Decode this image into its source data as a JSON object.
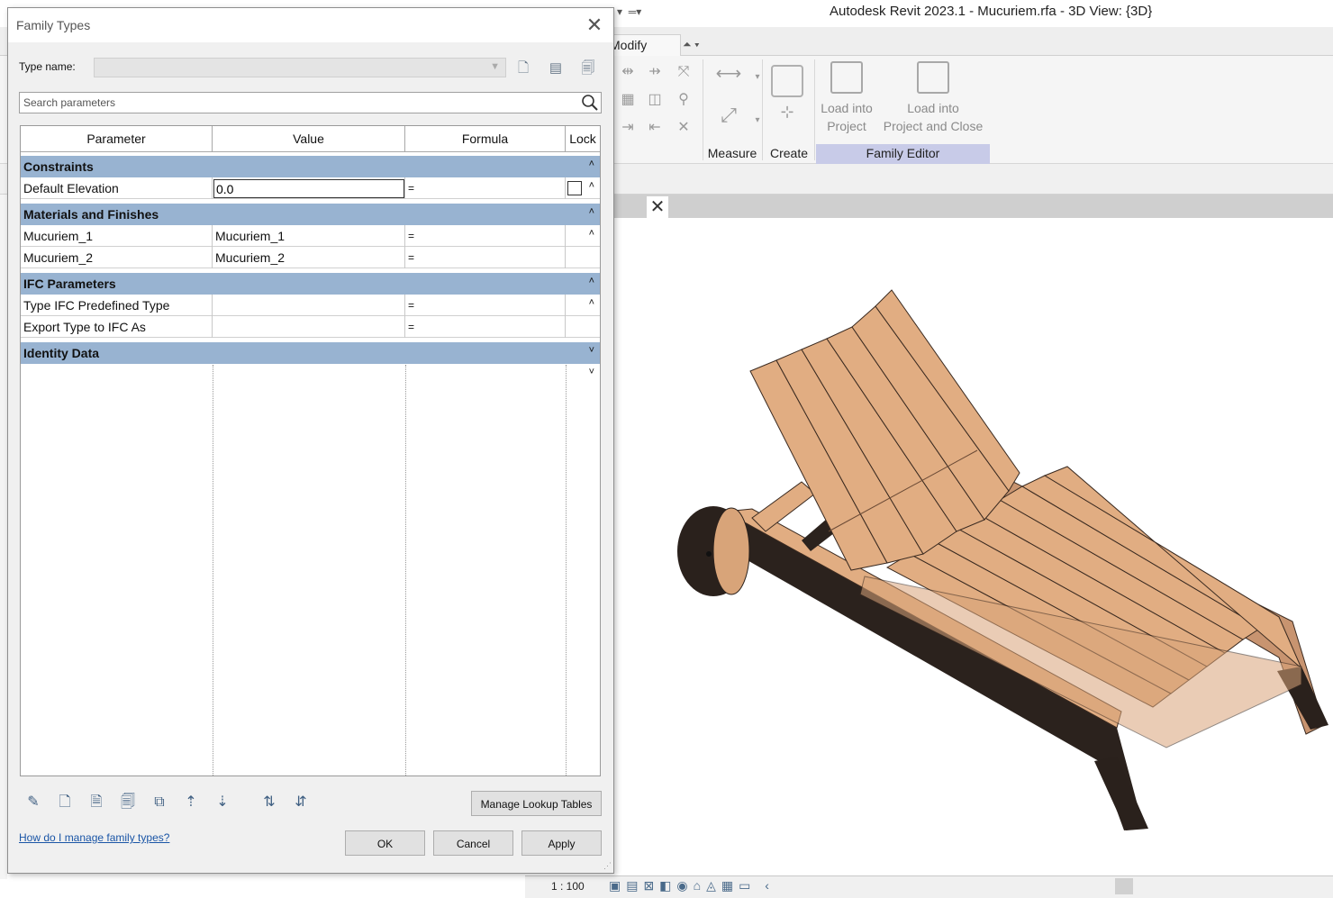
{
  "app": {
    "title": "Autodesk Revit 2023.1 - Mucuriem.rfa - 3D View: {3D}"
  },
  "ribbon": {
    "active_tab": "Modify",
    "panels": {
      "measure": "Measure",
      "create": "Create",
      "family_editor": "Family Editor"
    },
    "load_into_project": [
      "Load into",
      "Project"
    ],
    "load_into_project_close": [
      "Load into",
      "Project and Close"
    ]
  },
  "status": {
    "scale": "1 : 100"
  },
  "dialog": {
    "title": "Family Types",
    "type_name_label": "Type name:",
    "type_name_value": "",
    "search_placeholder": "Search parameters",
    "columns": [
      "Parameter",
      "Value",
      "Formula",
      "Lock"
    ],
    "groups": [
      {
        "name": "Constraints",
        "rows": [
          {
            "parameter": "Default Elevation",
            "value": "0.0",
            "formula": "=",
            "lock": false
          }
        ]
      },
      {
        "name": "Materials and Finishes",
        "rows": [
          {
            "parameter": "Mucuriem_1",
            "value": "Mucuriem_1",
            "formula": "="
          },
          {
            "parameter": "Mucuriem_2",
            "value": "Mucuriem_2",
            "formula": "="
          }
        ]
      },
      {
        "name": "IFC Parameters",
        "rows": [
          {
            "parameter": "Type IFC Predefined Type",
            "value": "",
            "formula": "="
          },
          {
            "parameter": "Export Type to IFC As",
            "value": "",
            "formula": "="
          }
        ]
      },
      {
        "name": "Identity Data",
        "rows": []
      }
    ],
    "manage_lookup_label": "Manage Lookup Tables",
    "help_link": "How do I manage family types?",
    "ok_label": "OK",
    "cancel_label": "Cancel",
    "apply_label": "Apply"
  },
  "colors": {
    "group_header": "#98b3d1",
    "family_editor_panel": "#c8cbe8",
    "link": "#1a55a6",
    "wood": "#e1ad82"
  }
}
